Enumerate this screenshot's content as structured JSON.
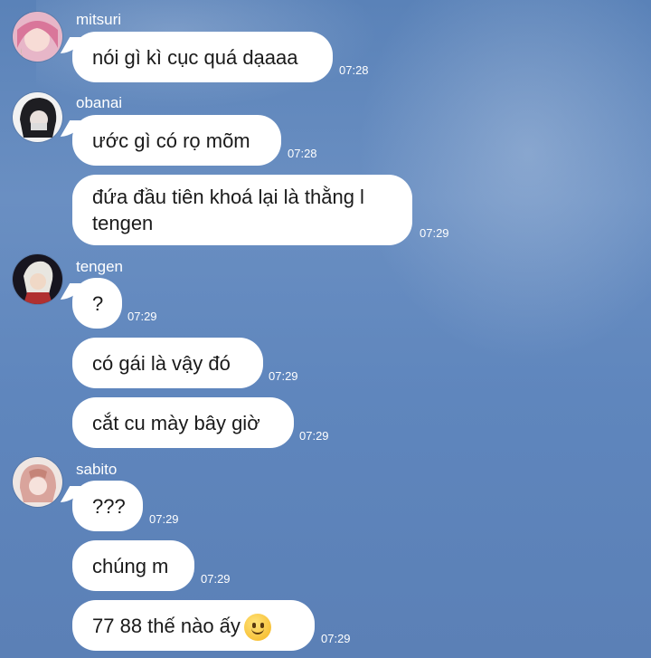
{
  "messages": {
    "mitsuri": {
      "name": "mitsuri",
      "texts": [
        "nói gì kì cục quá dạaaa"
      ],
      "times": [
        "07:28"
      ]
    },
    "obanai": {
      "name": "obanai",
      "texts": [
        "ước gì có rọ mõm",
        "đứa đầu tiên khoá lại là thằng l\ntengen"
      ],
      "times": [
        "07:28",
        "07:29"
      ]
    },
    "tengen": {
      "name": "tengen",
      "texts": [
        "?",
        "có gái là vậy đó",
        "cắt cu mày bây giờ"
      ],
      "times": [
        "07:29",
        "07:29",
        "07:29"
      ]
    },
    "sabito": {
      "name": "sabito",
      "texts": [
        "???",
        "chúng m",
        "77 88 thế nào ấy"
      ],
      "times": [
        "07:29",
        "07:29",
        "07:29"
      ]
    }
  },
  "icons": {
    "emoji": "slightly-smiling-face-icon"
  }
}
